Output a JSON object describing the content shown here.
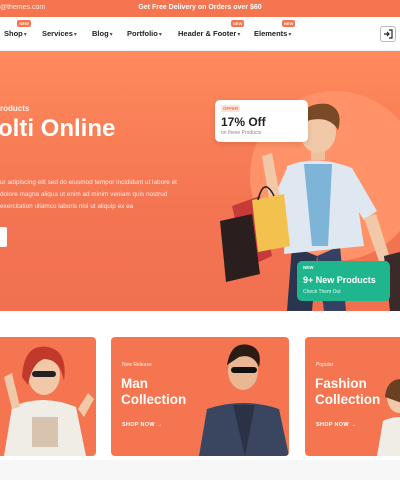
{
  "topbar": {
    "email": "@themes.com",
    "promo": "Get Free Delivery on Orders over $60"
  },
  "nav": {
    "items": [
      {
        "label": "Shop",
        "badge": "NEW"
      },
      {
        "label": "Services",
        "badge": ""
      },
      {
        "label": "Blog",
        "badge": ""
      },
      {
        "label": "Portfolio",
        "badge": ""
      },
      {
        "label": "Header & Footer",
        "badge": "NEW"
      },
      {
        "label": "Elements",
        "badge": "NEW"
      }
    ]
  },
  "hero": {
    "kicker": "roducts",
    "title": "olti Online",
    "description": "ur adipiscing elit sed do eiusmod tempor incididunt ut labore et dolore magna aliqua ut enim ad minim veniam quis nostrud exercitation ullamco laboris nisi ut aliquip ex ea",
    "offer": {
      "tag": "OFFER",
      "title": "17% Off",
      "subtitle": "on these Products"
    },
    "new_products": {
      "tag": "NEW",
      "title": "9+ New Products",
      "subtitle": "Check Them Out"
    }
  },
  "collections": [
    {
      "kicker": "",
      "title": "",
      "link": ""
    },
    {
      "kicker": "New Release",
      "title": "Man\nCollection",
      "link": "SHOP NOW →"
    },
    {
      "kicker": "Popular",
      "title": "Fashion\nCollection",
      "link": "SHOP NOW →"
    }
  ],
  "colors": {
    "accent": "#f4754f",
    "green": "#1fb58d"
  }
}
